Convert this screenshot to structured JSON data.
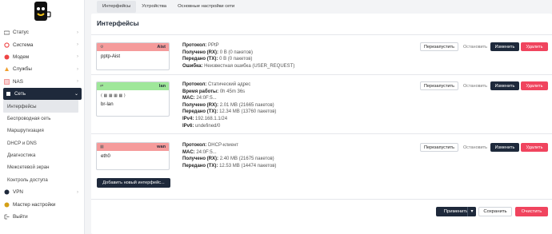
{
  "tabs": [
    "Интерфейсы",
    "Устройства",
    "Основные настройки сети"
  ],
  "sidebar": {
    "items": [
      {
        "label": "Статус",
        "icon": "status-icon"
      },
      {
        "label": "Система",
        "icon": "gear-icon"
      },
      {
        "label": "Модем",
        "icon": "modem-icon"
      },
      {
        "label": "Службы",
        "icon": "services-icon"
      },
      {
        "label": "NAS",
        "icon": "nas-icon"
      },
      {
        "label": "Сеть",
        "icon": "network-icon"
      }
    ],
    "subitems": [
      "Интерфейсы",
      "Беспроводная сеть",
      "Маршрутизация",
      "DHCP и DNS",
      "Диагностика",
      "Межсетевой экран",
      "Контроль доступа"
    ],
    "bottom": [
      {
        "label": "VPN",
        "icon": "vpn-icon"
      },
      {
        "label": "Мастер настройки",
        "icon": "wizard-icon"
      },
      {
        "label": "Выйти",
        "icon": "logout-icon"
      }
    ]
  },
  "panel_title": "Интерфейсы",
  "interfaces": [
    {
      "name": "Aist",
      "device": "pptp-Aist",
      "color": "#f59b9b",
      "lines": [
        {
          "k": "Протокол:",
          "v": "PPtP"
        },
        {
          "k": "Получено (RX):",
          "v": "0 B (0 пакетов)"
        },
        {
          "k": "Передано (TX):",
          "v": "0 B (0 пакетов)"
        },
        {
          "k": "Ошибка:",
          "v": "Неизвестная ошибка (USER_REQUEST)"
        }
      ]
    },
    {
      "name": "lan",
      "device": "br-lan",
      "color": "#9fe79a",
      "lines": [
        {
          "k": "Протокол:",
          "v": "Статический адрес"
        },
        {
          "k": "Время работы:",
          "v": "0h 45m 36s"
        },
        {
          "k": "MAC:",
          "v": "24:0F:5..."
        },
        {
          "k": "Получено (RX):",
          "v": "2.01 MB (21665 пакетов)"
        },
        {
          "k": "Передано (TX):",
          "v": "12.34 MB (13760 пакетов)"
        },
        {
          "k": "IPv4:",
          "v": "192.168.1.1/24"
        },
        {
          "k": "IPv6:",
          "v": "undefined/0"
        }
      ]
    },
    {
      "name": "wan",
      "device": "eth0",
      "color": "#f59b9b",
      "lines": [
        {
          "k": "Протокол:",
          "v": "DHCP-клиент"
        },
        {
          "k": "MAC:",
          "v": "24:0F:5..."
        },
        {
          "k": "Получено (RX):",
          "v": "2.40 MB (21675 пакетов)"
        },
        {
          "k": "Передано (TX):",
          "v": "12.53 MB (14474 пакетов)"
        }
      ]
    }
  ],
  "row_buttons": {
    "restart": "Перезапустить",
    "stop": "Остановить",
    "edit": "Изменить",
    "delete": "Удалить"
  },
  "add_button": "Добавить новый интерфейс...",
  "footer": {
    "apply": "Применить",
    "caret": "▾",
    "save": "Сохранить",
    "clear": "Очистить"
  }
}
